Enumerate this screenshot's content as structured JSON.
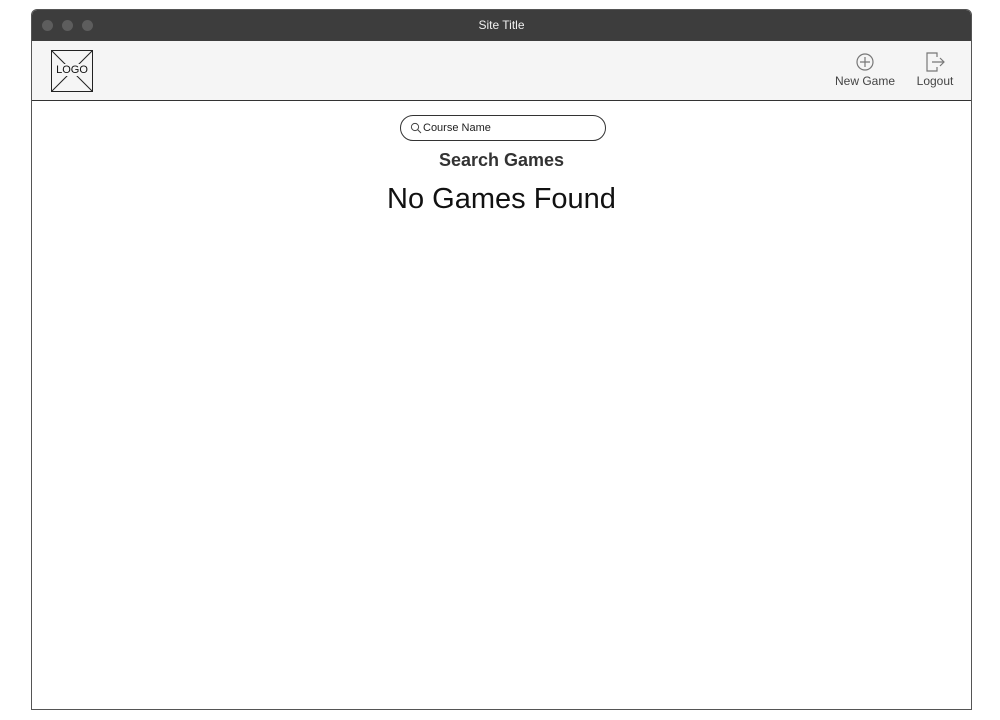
{
  "window": {
    "title": "Site Title"
  },
  "header": {
    "logo_text": "LOGO",
    "actions": [
      {
        "label": "New Game",
        "icon": "plus-circle-icon"
      },
      {
        "label": "Logout",
        "icon": "logout-icon"
      }
    ]
  },
  "search": {
    "value": "Course Name",
    "icon": "search-icon"
  },
  "main": {
    "heading": "Search Games",
    "empty_message": "No Games Found"
  },
  "colors": {
    "titlebar": "#3d3d3d",
    "header_bg": "#f5f5f5",
    "text_dark": "#111111"
  }
}
